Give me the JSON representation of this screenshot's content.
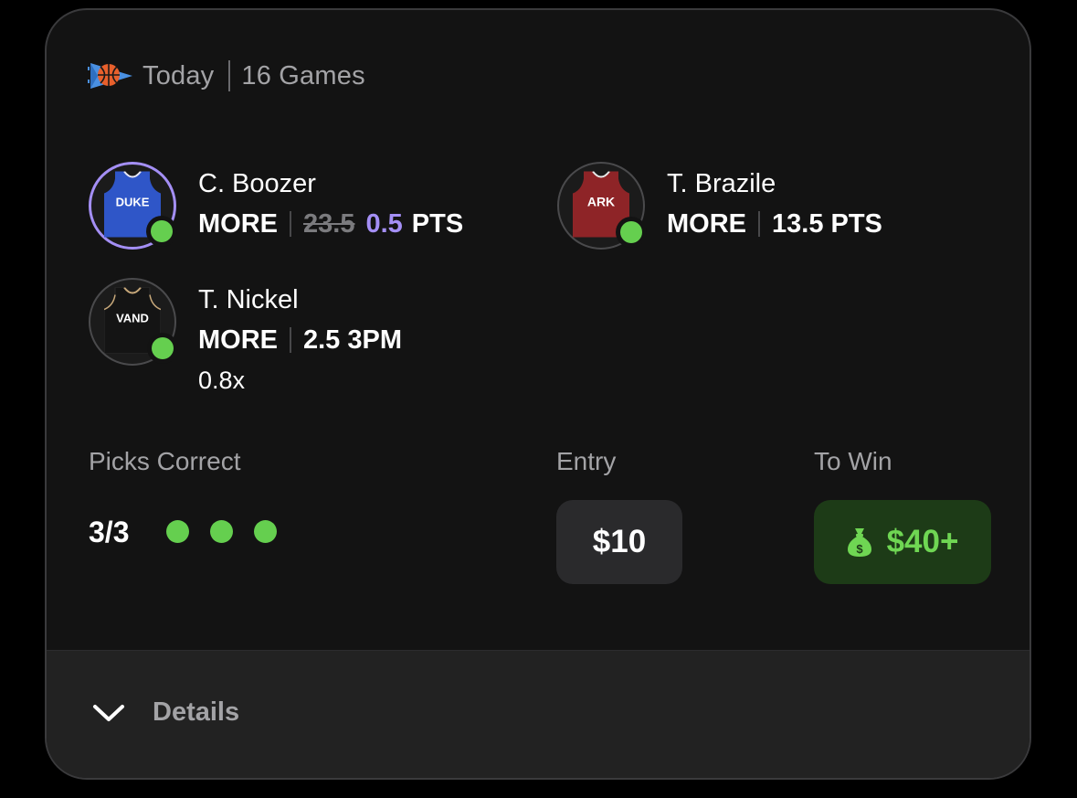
{
  "header": {
    "sport_icon": "basketball-icon",
    "date_label": "Today",
    "games_label": "16 Games"
  },
  "picks": [
    {
      "player": "C. Boozer",
      "team": "DUKE",
      "jersey_color": "#2f56c8",
      "direction": "MORE",
      "old_line": "23.5",
      "line": "0.5",
      "stat": "PTS",
      "result": "hit"
    },
    {
      "player": "T. Brazile",
      "team": "ARK",
      "jersey_color": "#8e2427",
      "direction": "MORE",
      "line": "13.5 PTS",
      "result": "hit"
    },
    {
      "player": "T. Nickel",
      "team": "VAND",
      "jersey_color": "#141414",
      "direction": "MORE",
      "line": "2.5 3PM",
      "multiplier": "0.8x",
      "result": "hit"
    }
  ],
  "summary": {
    "picks_correct_label": "Picks Correct",
    "picks_correct_value": "3/3",
    "entry_label": "Entry",
    "entry_value": "$10",
    "to_win_label": "To Win",
    "to_win_value": "$40+",
    "to_win_icon": "money-bag-icon"
  },
  "footer": {
    "details_label": "Details",
    "details_icon": "chevron-down-icon"
  },
  "colors": {
    "accent_purple": "#a48ff5",
    "success_green": "#65cf4f",
    "card_background": "#131313"
  }
}
